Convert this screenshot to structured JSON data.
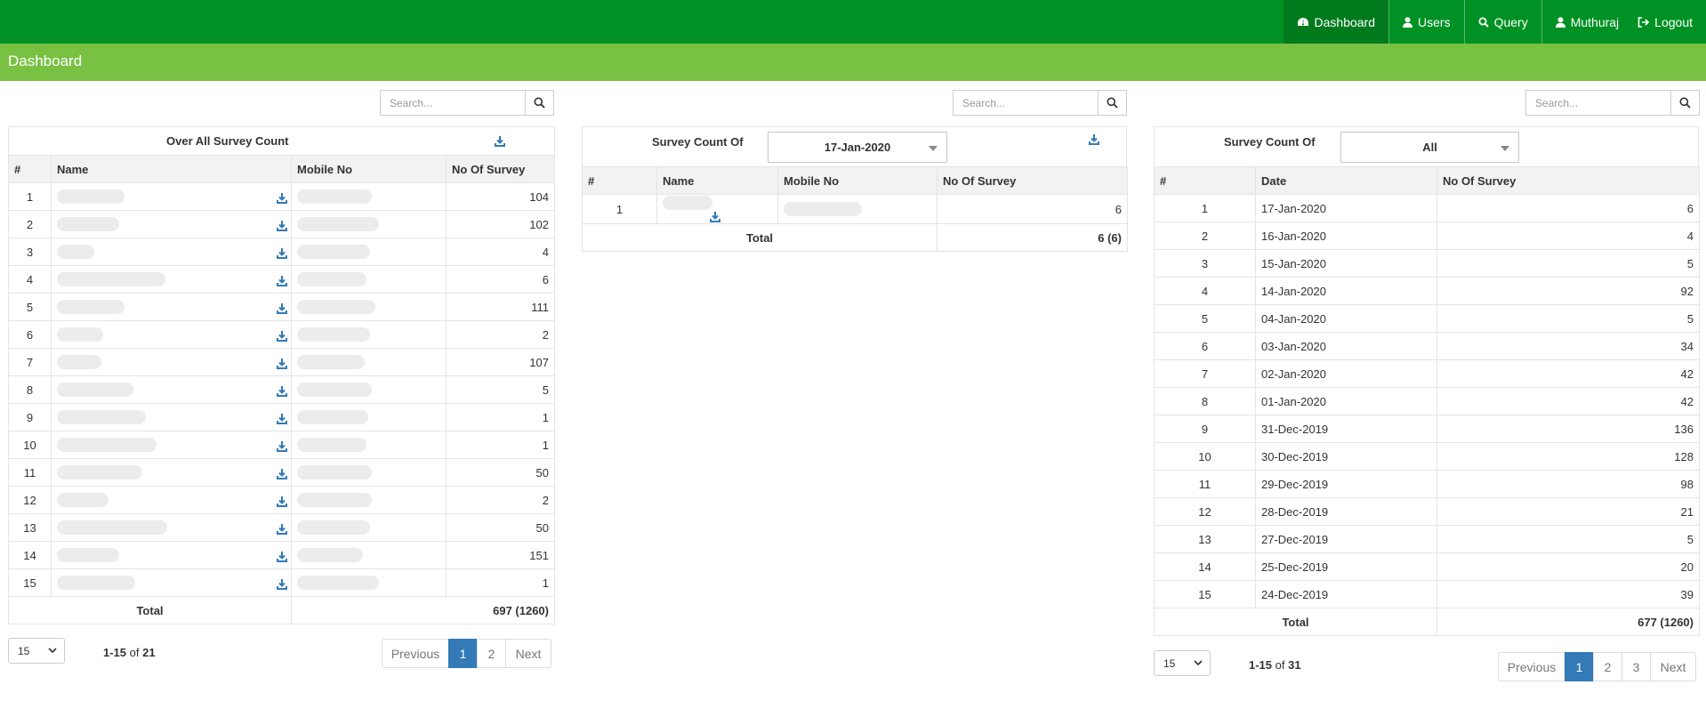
{
  "nav": {
    "dashboard": "Dashboard",
    "users": "Users",
    "query": "Query",
    "user": "Muthuraj",
    "logout": "Logout"
  },
  "page_title": "Dashboard",
  "colors": {
    "topbar": "#009124",
    "subbar": "#79c143",
    "accent": "#337ab7"
  },
  "overall": {
    "search_placeholder": "Search...",
    "title": "Over All Survey Count",
    "columns": [
      "#",
      "Name",
      "Mobile No",
      "No Of Survey"
    ],
    "counts": [
      "104",
      "102",
      "4",
      "6",
      "111",
      "2",
      "107",
      "5",
      "1",
      "1",
      "50",
      "2",
      "50",
      "151",
      "1"
    ],
    "total_label": "Total",
    "total_value": "697 (1260)",
    "page_size": "15",
    "info_range": "1-15",
    "info_of": "of",
    "info_total": "21",
    "pager": [
      "Previous",
      "1",
      "2",
      "Next"
    ]
  },
  "daily": {
    "search_placeholder": "Search...",
    "title": "Survey Count Of",
    "date_selected": "17-Jan-2020",
    "columns": [
      "#",
      "Name",
      "Mobile No",
      "No Of Survey"
    ],
    "row_num": "1",
    "row_count": "6",
    "total_label": "Total",
    "total_value": "6 (6)"
  },
  "dates": {
    "search_placeholder": "Search...",
    "title": "Survey Count Of",
    "filter_selected": "All",
    "columns": [
      "#",
      "Date",
      "No Of Survey"
    ],
    "rows": [
      [
        "1",
        "17-Jan-2020",
        "6"
      ],
      [
        "2",
        "16-Jan-2020",
        "4"
      ],
      [
        "3",
        "15-Jan-2020",
        "5"
      ],
      [
        "4",
        "14-Jan-2020",
        "92"
      ],
      [
        "5",
        "04-Jan-2020",
        "5"
      ],
      [
        "6",
        "03-Jan-2020",
        "34"
      ],
      [
        "7",
        "02-Jan-2020",
        "42"
      ],
      [
        "8",
        "01-Jan-2020",
        "42"
      ],
      [
        "9",
        "31-Dec-2019",
        "136"
      ],
      [
        "10",
        "30-Dec-2019",
        "128"
      ],
      [
        "11",
        "29-Dec-2019",
        "98"
      ],
      [
        "12",
        "28-Dec-2019",
        "21"
      ],
      [
        "13",
        "27-Dec-2019",
        "5"
      ],
      [
        "14",
        "25-Dec-2019",
        "20"
      ],
      [
        "15",
        "24-Dec-2019",
        "39"
      ]
    ],
    "total_label": "Total",
    "total_value": "677 (1260)",
    "page_size": "15",
    "info_range": "1-15",
    "info_of": "of",
    "info_total": "31",
    "pager": [
      "Previous",
      "1",
      "2",
      "3",
      "Next"
    ]
  }
}
